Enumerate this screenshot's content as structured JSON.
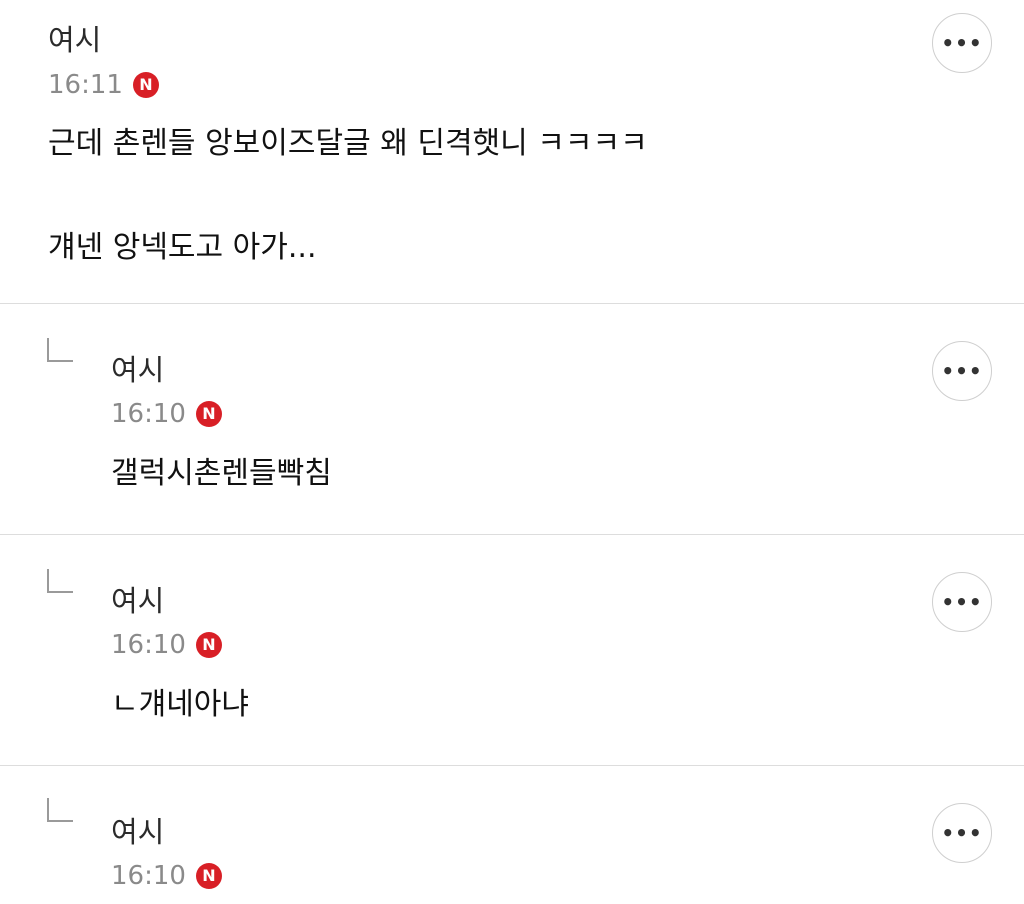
{
  "comments": [
    {
      "author": "여시",
      "time": "16:11",
      "badge": "N",
      "body_lines": [
        "근데 촌렌들 앙보이즈달글 왜 딘격햇니 ㅋㅋㅋㅋ",
        "",
        "걔넨 앙넥도고 아가..."
      ],
      "is_reply": false
    },
    {
      "author": "여시",
      "time": "16:10",
      "badge": "N",
      "body_lines": [
        "갤럭시촌렌들빡침"
      ],
      "is_reply": true
    },
    {
      "author": "여시",
      "time": "16:10",
      "badge": "N",
      "body_lines": [
        "ㄴ걔네아냐"
      ],
      "is_reply": true
    },
    {
      "author": "여시",
      "time": "16:10",
      "badge": "N",
      "body_lines": [],
      "is_reply": true
    }
  ],
  "icons": {
    "more": "more-options-icon",
    "reply": "reply-arrow-icon",
    "new": "new-badge-icon"
  },
  "more_glyph": "•••",
  "colors": {
    "badge": "#d81f26",
    "divider": "#dddddd",
    "time": "#8a8a8a",
    "text": "#111111"
  }
}
